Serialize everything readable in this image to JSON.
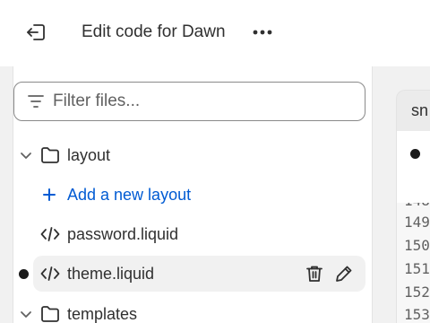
{
  "header": {
    "title": "Edit code for Dawn",
    "back_icon": "exit-icon",
    "more_icon": "ellipsis-icon"
  },
  "sidebar": {
    "filter": {
      "placeholder": "Filter files...",
      "value": ""
    },
    "tree": {
      "layout_folder": "layout",
      "add_layout": "Add a new layout",
      "password_file": "password.liquid",
      "theme_file": "theme.liquid",
      "templates_folder": "templates"
    }
  },
  "editor": {
    "tab_label": "sn",
    "line_numbers": [
      "149",
      "150",
      "151",
      "152",
      "153"
    ]
  },
  "colors": {
    "link": "#005bd3",
    "selected_row": "#f1f1f1",
    "background": "#f1f1f1"
  }
}
